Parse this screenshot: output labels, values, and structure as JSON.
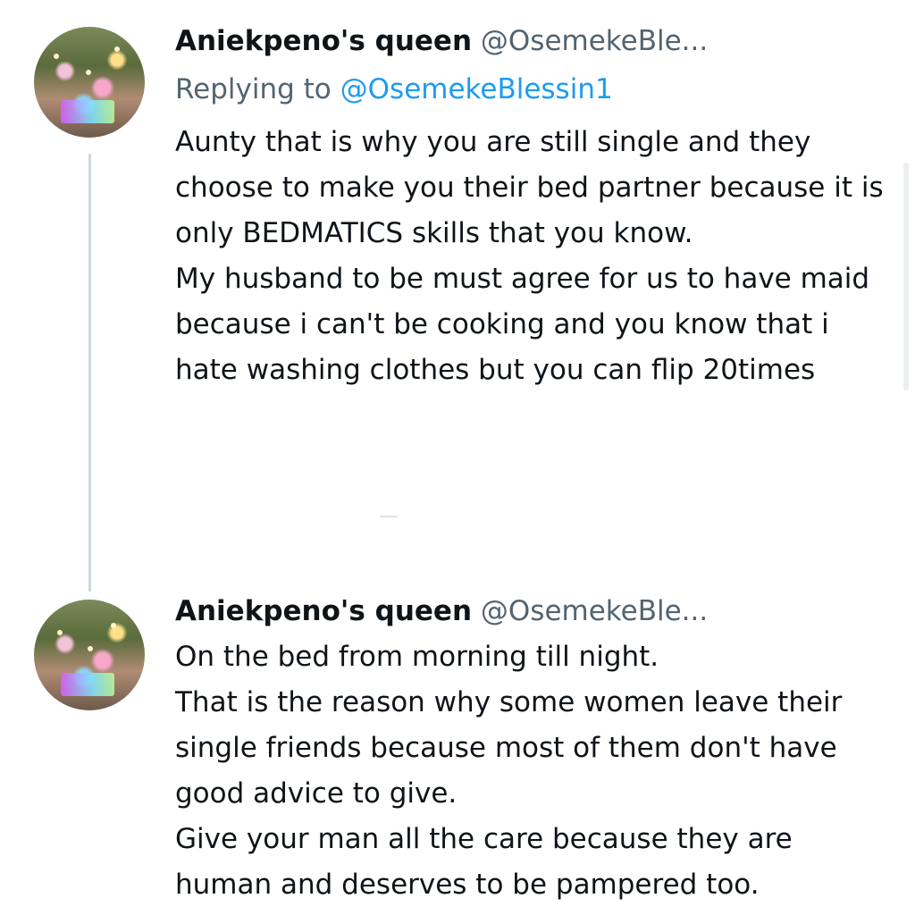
{
  "tweets": [
    {
      "name": "Aniekpeno's queen",
      "handle": "@OsemekeBle...",
      "replying_label": "Replying to",
      "replying_to": "@OsemekeBlessin1",
      "paragraphs": [
        "Aunty that is why you are still single and they choose to make you their bed partner because it is only BEDMATICS skills that you know.",
        "My husband to be must agree for us to have maid because i can't be cooking and you know that i hate washing clothes but you can flip 20times"
      ]
    },
    {
      "name": "Aniekpeno's queen",
      "handle": "@OsemekeBle...",
      "paragraphs": [
        "On the bed from morning till night.",
        "That is the reason why some women leave their single friends because most of them don't have good advice to give.",
        "Give your man all the care because they are human and deserves to be pampered too."
      ]
    }
  ],
  "icons": {
    "avatar": "profile-photo",
    "thread": "thread-connector-line"
  },
  "colors": {
    "text": "#0f1419",
    "secondary": "#536471",
    "mention": "#1d9bf0",
    "thread_line": "#cfd9de"
  }
}
